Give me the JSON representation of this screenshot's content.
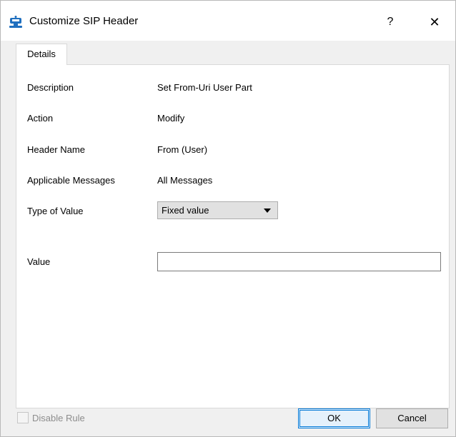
{
  "window": {
    "title": "Customize SIP Header",
    "help_label": "?",
    "close_label": "✕"
  },
  "tabs": [
    {
      "label": "Details"
    }
  ],
  "details": {
    "rows": [
      {
        "label": "Description",
        "value": "Set From-Uri User Part"
      },
      {
        "label": "Action",
        "value": "Modify"
      },
      {
        "label": "Header Name",
        "value": "From (User)"
      },
      {
        "label": "Applicable Messages",
        "value": "All Messages"
      }
    ],
    "type_of_value": {
      "label": "Type of Value",
      "selected": "Fixed value"
    },
    "value_field": {
      "label": "Value",
      "value": ""
    }
  },
  "footer": {
    "disable_rule_label": "Disable Rule",
    "ok_label": "OK",
    "cancel_label": "Cancel"
  },
  "colors": {
    "accent": "#0078d7",
    "icon_blue": "#1f6fbf"
  },
  "icons": [
    "sip-header-app-icon",
    "chevron-down-icon"
  ]
}
